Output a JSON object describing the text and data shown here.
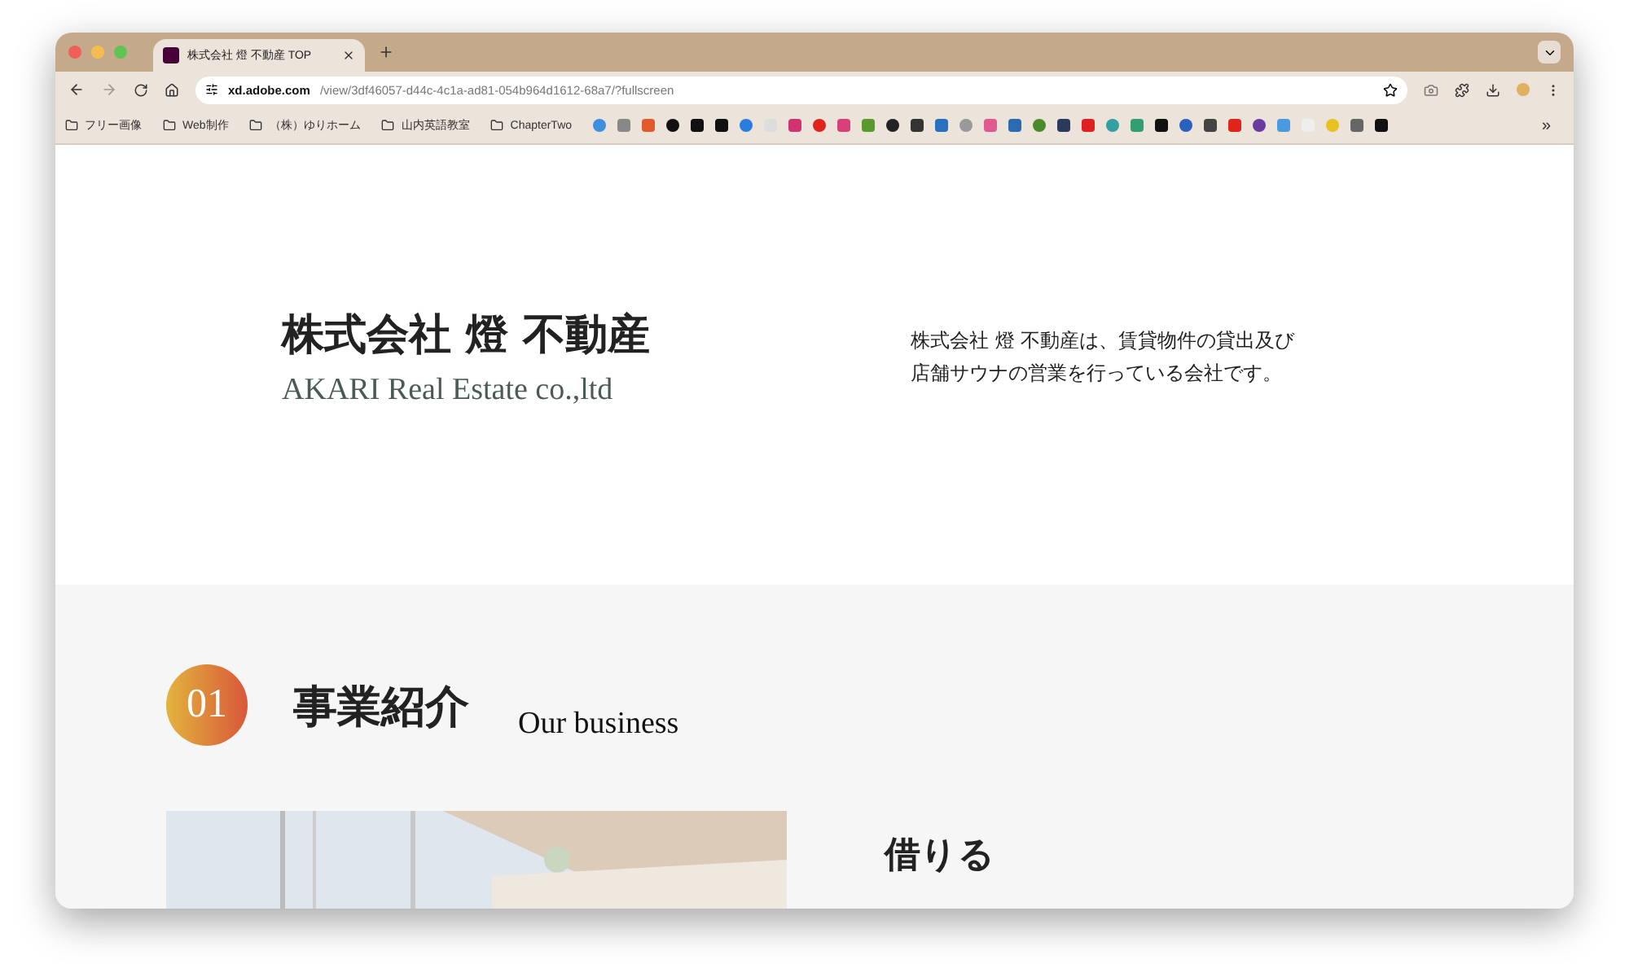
{
  "browser": {
    "tab": {
      "title": "株式会社 燈 不動産 TOP",
      "selected": true
    },
    "address": {
      "host": "xd.adobe.com",
      "path": "/view/3df46057-d44c-4c1a-ad81-054b964d1612-68a7/?fullscreen"
    },
    "bookmark_folders": [
      "フリー画像",
      "Web制作",
      "（株）ゆりホーム",
      "山内英語教室",
      "ChapterTwo"
    ],
    "overflow": "»"
  },
  "hero": {
    "title": "株式会社 燈 不動産",
    "subtitle": "AKARI Real Estate co.,ltd",
    "description": [
      "株式会社 燈 不動産は、賃貸物件の貸出及び",
      "店舗サウナの営業を行っている会社です。"
    ]
  },
  "section": {
    "number": "01",
    "title": "事業紹介",
    "subtitle": "Our business",
    "item_title": "借りる"
  }
}
